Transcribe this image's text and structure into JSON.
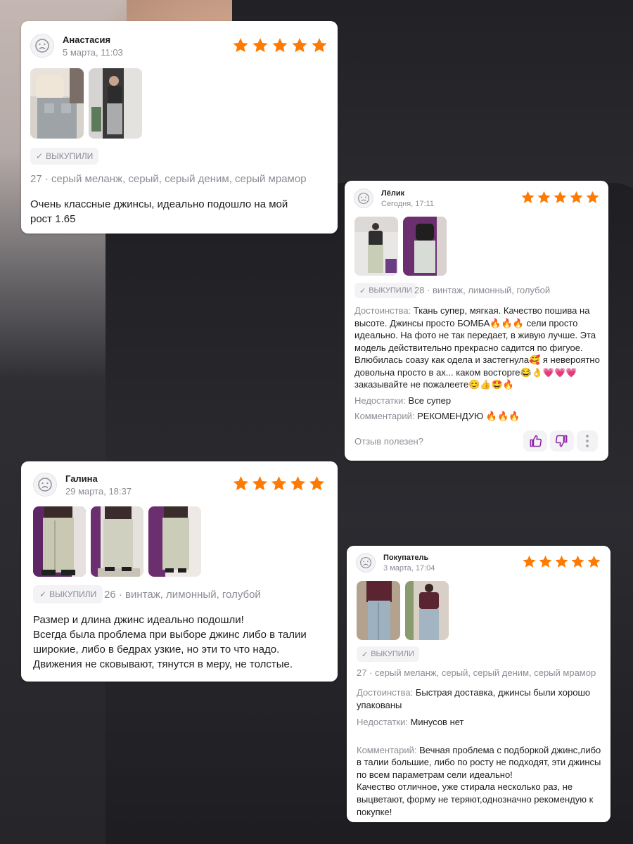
{
  "accent": "#ff7a00",
  "reviews": [
    {
      "author": "Анастасия",
      "date": "5 марта, 11:03",
      "rating": 5,
      "badge": "ВЫКУПИЛИ",
      "variant": "27 · серый меланж, серый, серый деним, серый мрамор",
      "text": "Очень классные джинсы, идеально подошло на мой\nрост 1.65"
    },
    {
      "author": "Лёлик",
      "date": "Сегодня, 17:11",
      "rating": 5,
      "badge": "ВЫКУПИЛИ",
      "variant": "28 · винтаж, лимонный, голубой",
      "pros_label": "Достоинства:",
      "pros": "Ткань супер, мягкая. Качество пошива на высоте. Джинсы просто БОМБА🔥🔥🔥 сели просто идеально. На фото не так передает, в живую лучше. Эта модель действительно прекрасно садится по фигуое. Влюбилась соазу как одела и застегнула🥰 я невероятно довольна просто в ах... каком восторге😂👌💗💗💗 заказывайте не пожалеете😊👍🤩🔥",
      "cons_label": "Недостатки:",
      "cons": "Все супер",
      "comment_label": "Комментарий:",
      "comment": "РЕКОМЕНДУЮ 🔥🔥🔥",
      "helpful_prompt": "Отзыв полезен?"
    },
    {
      "author": "Галина",
      "date": "29 марта, 18:37",
      "rating": 5,
      "badge": "ВЫКУПИЛИ",
      "variant": "26 · винтаж, лимонный, голубой",
      "text": "Размер и длина джинс идеально подошли!\nВсегда была проблема при выборе джинс либо в талии\nширокие, либо в бедрах узкие, но эти то что надо.\nДвижения не сковывают, тянутся в меру, не толстые."
    },
    {
      "author": "Покупатель",
      "date": "3 марта, 17:04",
      "rating": 5,
      "badge": "ВЫКУПИЛИ",
      "variant": "27 · серый меланж, серый, серый деним, серый мрамор",
      "pros_label": "Достоинства:",
      "pros": "Быстрая доставка, джинсы были хорошо упакованы",
      "cons_label": "Недостатки:",
      "cons": "Минусов нет",
      "comment_label": "Комментарий:",
      "comment": "Вечная проблема с подборкой джинс,либо в талии большие, либо по росту не подходят, эти джинсы по всем параметрам сели идеально!\nКачество отличное, уже стирала несколько раз, не выцветают, форму не теряют,однозначно рекомендую к покупке!"
    }
  ],
  "icons": {
    "avatar": "sad-face-avatar-icon",
    "star": "star-icon",
    "check": "check-icon",
    "like": "thumbs-up-icon",
    "dislike": "thumbs-down-icon",
    "more": "more-vertical-icon"
  }
}
